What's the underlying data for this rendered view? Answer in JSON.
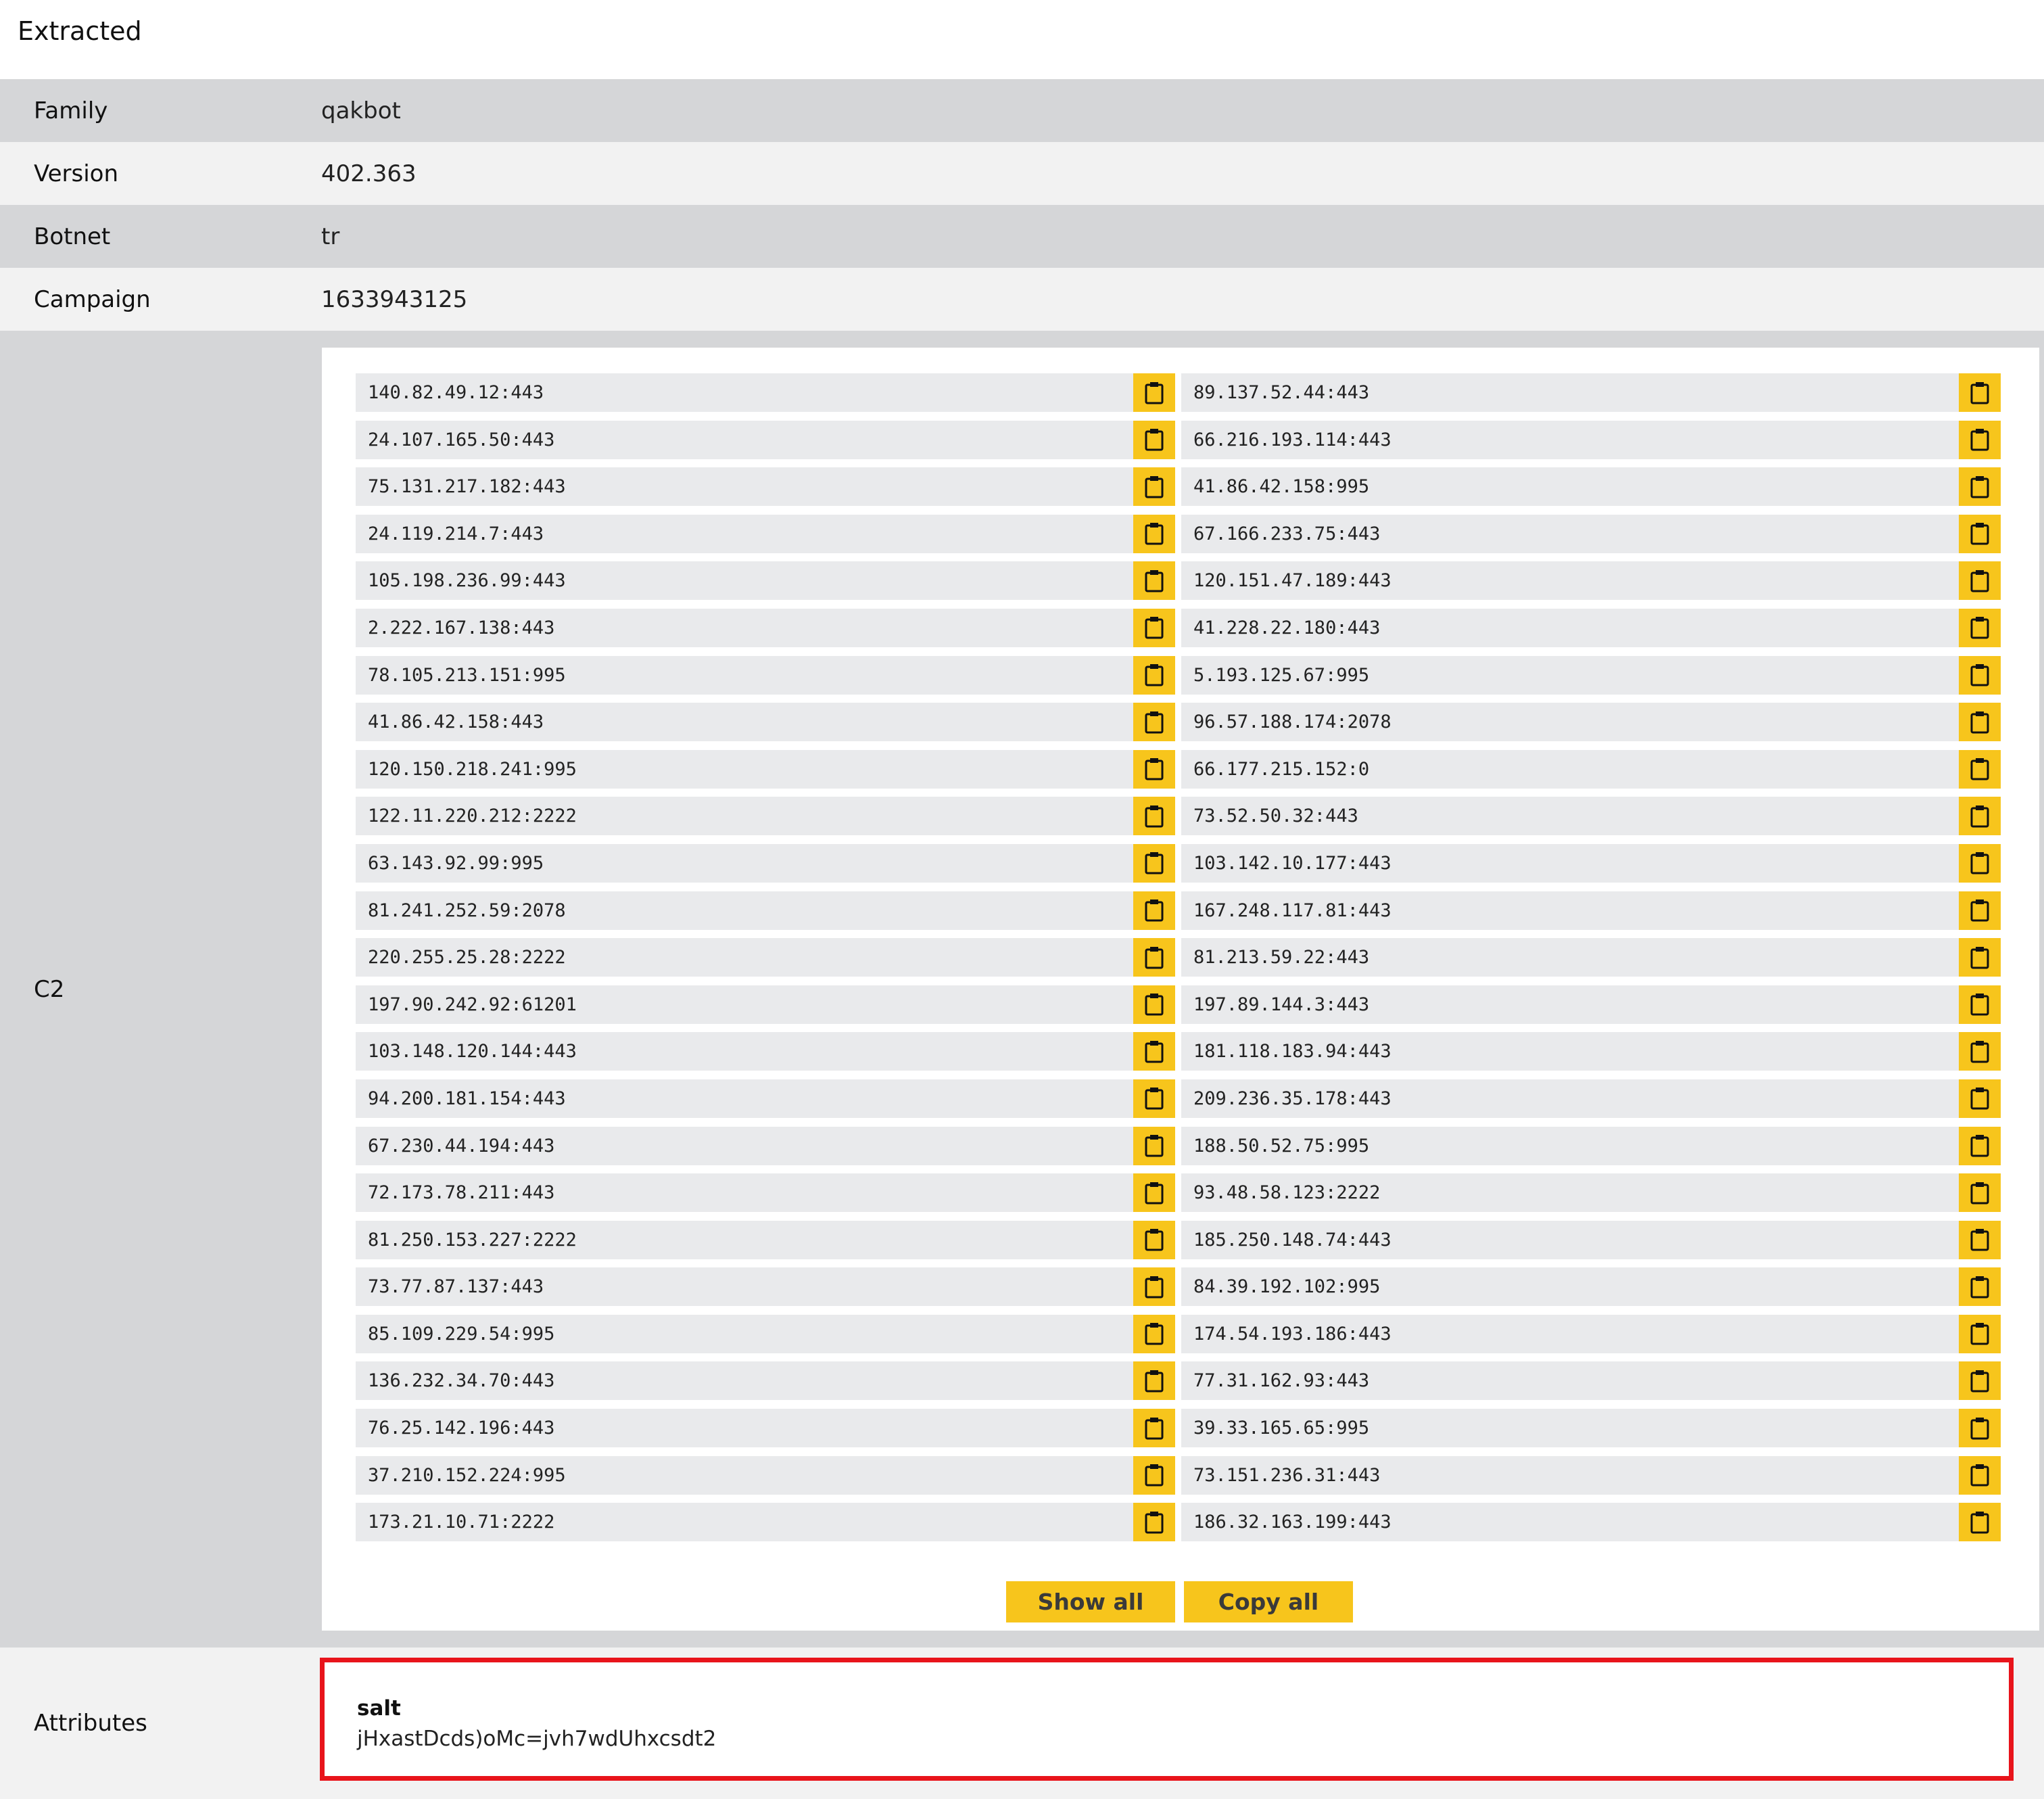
{
  "section_title": "Extracted",
  "fields": {
    "family": {
      "label": "Family",
      "value": "qakbot"
    },
    "version": {
      "label": "Version",
      "value": "402.363"
    },
    "botnet": {
      "label": "Botnet",
      "value": "tr"
    },
    "campaign": {
      "label": "Campaign",
      "value": "1633943125"
    }
  },
  "c2": {
    "label": "C2",
    "entries": [
      "140.82.49.12:443",
      "89.137.52.44:443",
      "24.107.165.50:443",
      "66.216.193.114:443",
      "75.131.217.182:443",
      "41.86.42.158:995",
      "24.119.214.7:443",
      "67.166.233.75:443",
      "105.198.236.99:443",
      "120.151.47.189:443",
      "2.222.167.138:443",
      "41.228.22.180:443",
      "78.105.213.151:995",
      "5.193.125.67:995",
      "41.86.42.158:443",
      "96.57.188.174:2078",
      "120.150.218.241:995",
      "66.177.215.152:0",
      "122.11.220.212:2222",
      "73.52.50.32:443",
      "63.143.92.99:995",
      "103.142.10.177:443",
      "81.241.252.59:2078",
      "167.248.117.81:443",
      "220.255.25.28:2222",
      "81.213.59.22:443",
      "197.90.242.92:61201",
      "197.89.144.3:443",
      "103.148.120.144:443",
      "181.118.183.94:443",
      "94.200.181.154:443",
      "209.236.35.178:443",
      "67.230.44.194:443",
      "188.50.52.75:995",
      "72.173.78.211:443",
      "93.48.58.123:2222",
      "81.250.153.227:2222",
      "185.250.148.74:443",
      "73.77.87.137:443",
      "84.39.192.102:995",
      "85.109.229.54:995",
      "174.54.193.186:443",
      "136.232.34.70:443",
      "77.31.162.93:443",
      "76.25.142.196:443",
      "39.33.165.65:995",
      "37.210.152.224:995",
      "73.151.236.31:443",
      "173.21.10.71:2222",
      "186.32.163.199:443"
    ],
    "copy_icon": "clipboard-icon",
    "show_all_label": "Show all",
    "copy_all_label": "Copy all"
  },
  "attributes": {
    "label": "Attributes",
    "key": "salt",
    "value": "jHxastDcds)oMc=jvh7wdUhxcsdt2"
  },
  "colors": {
    "accent_yellow": "#f7c51c",
    "highlight_red": "#e8141b"
  }
}
